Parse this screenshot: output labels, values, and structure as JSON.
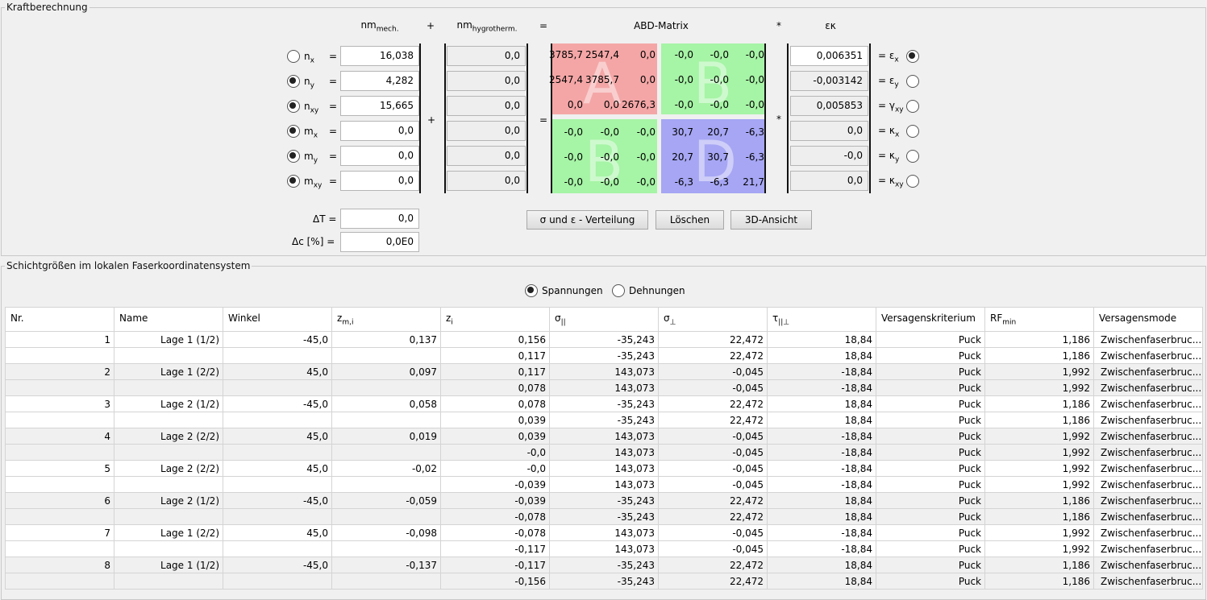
{
  "kraft": {
    "legend": "Kraftberechnung",
    "headers": {
      "nm_mech_base": "nm",
      "nm_mech_sub": "mech.",
      "plus": "+",
      "nm_hyg_base": "nm",
      "nm_hyg_sub": "hygrotherm.",
      "equals": "=",
      "abd": "ABD-Matrix",
      "star": "*",
      "eps": "εκ"
    },
    "mid_plus": "+",
    "mid_equals": "=",
    "mid_star": "*",
    "rows": [
      {
        "sym": "n",
        "sub": "x",
        "checked": false,
        "mech": "16,038",
        "hyg": "0,0",
        "eps": "0,006351",
        "esym": "= ε",
        "esub": "x",
        "echecked": true,
        "eps_editable": true
      },
      {
        "sym": "n",
        "sub": "y",
        "checked": true,
        "mech": "4,282",
        "hyg": "0,0",
        "eps": "-0,003142",
        "esym": "= ε",
        "esub": "y",
        "echecked": false,
        "eps_editable": false
      },
      {
        "sym": "n",
        "sub": "xy",
        "checked": true,
        "mech": "15,665",
        "hyg": "0,0",
        "eps": "0,005853",
        "esym": "= γ",
        "esub": "xy",
        "echecked": false,
        "eps_editable": false
      },
      {
        "sym": "m",
        "sub": "x",
        "checked": true,
        "mech": "0,0",
        "hyg": "0,0",
        "eps": "0,0",
        "esym": "= κ",
        "esub": "x",
        "echecked": false,
        "eps_editable": false
      },
      {
        "sym": "m",
        "sub": "y",
        "checked": true,
        "mech": "0,0",
        "hyg": "0,0",
        "eps": "-0,0",
        "esym": "= κ",
        "esub": "y",
        "echecked": false,
        "eps_editable": false
      },
      {
        "sym": "m",
        "sub": "xy",
        "checked": true,
        "mech": "0,0",
        "hyg": "0,0",
        "eps": "0,0",
        "esym": "= κ",
        "esub": "xy",
        "echecked": false,
        "eps_editable": false
      }
    ],
    "abd": {
      "letters": {
        "A": "A",
        "B1": "B",
        "B2": "B",
        "D": "D"
      },
      "colors": {
        "A": "#f4a6a6",
        "B": "#a6f4a6",
        "D": "#a6a6f4"
      },
      "rows": [
        [
          "3785,7",
          "2547,4",
          "0,0",
          "-0,0",
          "-0,0",
          "-0,0"
        ],
        [
          "2547,4",
          "3785,7",
          "0,0",
          "-0,0",
          "-0,0",
          "-0,0"
        ],
        [
          "0,0",
          "0,0",
          "2676,3",
          "-0,0",
          "-0,0",
          "-0,0"
        ],
        [
          "-0,0",
          "-0,0",
          "-0,0",
          "30,7",
          "20,7",
          "-6,3"
        ],
        [
          "-0,0",
          "-0,0",
          "-0,0",
          "20,7",
          "30,7",
          "-6,3"
        ],
        [
          "-0,0",
          "-0,0",
          "-0,0",
          "-6,3",
          "-6,3",
          "21,7"
        ]
      ]
    },
    "dT_label": "ΔT =",
    "dT_value": "0,0",
    "dc_label": "Δc [%] =",
    "dc_value": "0,0E0",
    "buttons": {
      "verteilung": "σ und ε - Verteilung",
      "loeschen": "Löschen",
      "ansicht3d": "3D-Ansicht"
    }
  },
  "schicht": {
    "legend": "Schichtgrößen im lokalen Faserkoordinatensystem",
    "radio_spannungen": "Spannungen",
    "radio_dehnungen": "Dehnungen",
    "radio_selected": "Spannungen",
    "columns": [
      {
        "base": "Nr.",
        "sub": ""
      },
      {
        "base": "Name",
        "sub": ""
      },
      {
        "base": "Winkel",
        "sub": ""
      },
      {
        "base": "z",
        "sub": "m,i"
      },
      {
        "base": "z",
        "sub": "i"
      },
      {
        "base": "σ",
        "sub": "||"
      },
      {
        "base": "σ",
        "sub": "⊥"
      },
      {
        "base": "τ",
        "sub": "||⊥"
      },
      {
        "base": "Versagenskriterium",
        "sub": ""
      },
      {
        "base": "RF",
        "sub": "min"
      },
      {
        "base": "Versagensmode",
        "sub": ""
      }
    ],
    "rows": [
      [
        "1",
        "Lage 1 (1/2)",
        "-45,0",
        "0,137",
        "0,156",
        "-35,243",
        "22,472",
        "18,84",
        "Puck",
        "1,186",
        "Zwischenfaserbruc..."
      ],
      [
        "",
        "",
        "",
        "",
        "0,117",
        "-35,243",
        "22,472",
        "18,84",
        "Puck",
        "1,186",
        "Zwischenfaserbruc..."
      ],
      [
        "2",
        "Lage 1 (2/2)",
        "45,0",
        "0,097",
        "0,117",
        "143,073",
        "-0,045",
        "-18,84",
        "Puck",
        "1,992",
        "Zwischenfaserbruc..."
      ],
      [
        "",
        "",
        "",
        "",
        "0,078",
        "143,073",
        "-0,045",
        "-18,84",
        "Puck",
        "1,992",
        "Zwischenfaserbruc..."
      ],
      [
        "3",
        "Lage 2 (1/2)",
        "-45,0",
        "0,058",
        "0,078",
        "-35,243",
        "22,472",
        "18,84",
        "Puck",
        "1,186",
        "Zwischenfaserbruc..."
      ],
      [
        "",
        "",
        "",
        "",
        "0,039",
        "-35,243",
        "22,472",
        "18,84",
        "Puck",
        "1,186",
        "Zwischenfaserbruc..."
      ],
      [
        "4",
        "Lage 2 (2/2)",
        "45,0",
        "0,019",
        "0,039",
        "143,073",
        "-0,045",
        "-18,84",
        "Puck",
        "1,992",
        "Zwischenfaserbruc..."
      ],
      [
        "",
        "",
        "",
        "",
        "-0,0",
        "143,073",
        "-0,045",
        "-18,84",
        "Puck",
        "1,992",
        "Zwischenfaserbruc..."
      ],
      [
        "5",
        "Lage 2 (2/2)",
        "45,0",
        "-0,02",
        "-0,0",
        "143,073",
        "-0,045",
        "-18,84",
        "Puck",
        "1,992",
        "Zwischenfaserbruc..."
      ],
      [
        "",
        "",
        "",
        "",
        "-0,039",
        "143,073",
        "-0,045",
        "-18,84",
        "Puck",
        "1,992",
        "Zwischenfaserbruc..."
      ],
      [
        "6",
        "Lage 2 (1/2)",
        "-45,0",
        "-0,059",
        "-0,039",
        "-35,243",
        "22,472",
        "18,84",
        "Puck",
        "1,186",
        "Zwischenfaserbruc..."
      ],
      [
        "",
        "",
        "",
        "",
        "-0,078",
        "-35,243",
        "22,472",
        "18,84",
        "Puck",
        "1,186",
        "Zwischenfaserbruc..."
      ],
      [
        "7",
        "Lage 1 (2/2)",
        "45,0",
        "-0,098",
        "-0,078",
        "143,073",
        "-0,045",
        "-18,84",
        "Puck",
        "1,992",
        "Zwischenfaserbruc..."
      ],
      [
        "",
        "",
        "",
        "",
        "-0,117",
        "143,073",
        "-0,045",
        "-18,84",
        "Puck",
        "1,992",
        "Zwischenfaserbruc..."
      ],
      [
        "8",
        "Lage 1 (1/2)",
        "-45,0",
        "-0,137",
        "-0,117",
        "-35,243",
        "22,472",
        "18,84",
        "Puck",
        "1,186",
        "Zwischenfaserbruc..."
      ],
      [
        "",
        "",
        "",
        "",
        "-0,156",
        "-35,243",
        "22,472",
        "18,84",
        "Puck",
        "1,186",
        "Zwischenfaserbruc..."
      ]
    ]
  }
}
